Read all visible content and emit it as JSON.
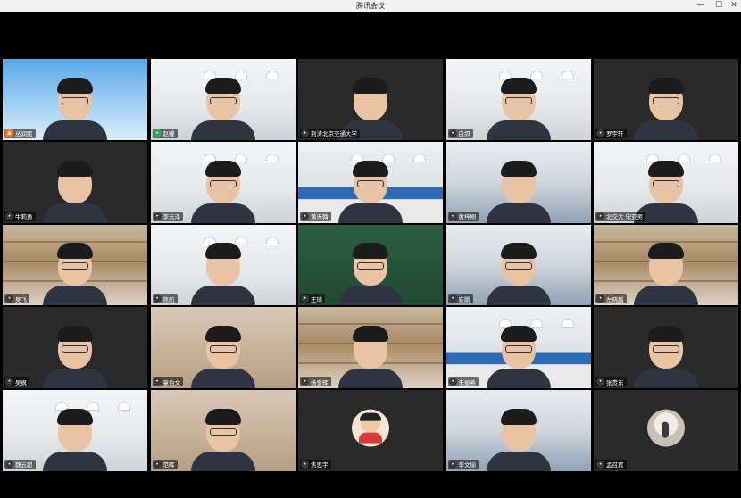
{
  "window": {
    "title": "腾讯会议"
  },
  "controls": {
    "minimize": "—",
    "maximize": "☐",
    "close": "✕"
  },
  "participants": [
    {
      "name": "丛润民",
      "mic": "orange",
      "bg": "bg-sky"
    },
    {
      "name": "赵耀",
      "mic": "green",
      "bg": "bg-white"
    },
    {
      "name": "荆涛北京交通大学",
      "mic": "gray",
      "bg": "bg-dark"
    },
    {
      "name": "白鸽",
      "mic": "gray",
      "bg": "bg-white"
    },
    {
      "name": "罗宇轩",
      "mic": "gray",
      "bg": "bg-dark"
    },
    {
      "name": "牛莉勇",
      "mic": "gray",
      "bg": "bg-dark"
    },
    {
      "name": "李元泽",
      "mic": "gray",
      "bg": "bg-white"
    },
    {
      "name": "黄天翰",
      "mic": "gray",
      "bg": "bg-room"
    },
    {
      "name": "黄梓桐",
      "mic": "gray",
      "bg": "bg-office"
    },
    {
      "name": "北交大 宋亚男",
      "mic": "gray",
      "bg": "bg-white"
    },
    {
      "name": "吴飞",
      "mic": "gray",
      "bg": "bg-shelf"
    },
    {
      "name": "熊航",
      "mic": "gray",
      "bg": "bg-white"
    },
    {
      "name": "王琦",
      "mic": "gray",
      "bg": "bg-green"
    },
    {
      "name": "崔鹏",
      "mic": "gray",
      "bg": "bg-office"
    },
    {
      "name": "左晓越",
      "mic": "gray",
      "bg": "bg-shelf"
    },
    {
      "name": "吴枫",
      "mic": "gray",
      "bg": "bg-dark"
    },
    {
      "name": "童伯文",
      "mic": "gray",
      "bg": "bg-warm"
    },
    {
      "name": "杨爱辉",
      "mic": "gray",
      "bg": "bg-shelf"
    },
    {
      "name": "朱振希",
      "mic": "gray",
      "bg": "bg-room"
    },
    {
      "name": "张贵东",
      "mic": "gray",
      "bg": "bg-dark"
    },
    {
      "name": "魏云超",
      "mic": "gray",
      "bg": "bg-white"
    },
    {
      "name": "范晖",
      "mic": "gray",
      "bg": "bg-warm"
    },
    {
      "name": "焦思宇",
      "mic": "gray",
      "bg": "bg-dark",
      "avatar": "cartoon"
    },
    {
      "name": "李文瑜",
      "mic": "gray",
      "bg": "bg-office"
    },
    {
      "name": "孟召宾",
      "mic": "gray",
      "bg": "bg-dark",
      "avatar": "photo"
    }
  ]
}
